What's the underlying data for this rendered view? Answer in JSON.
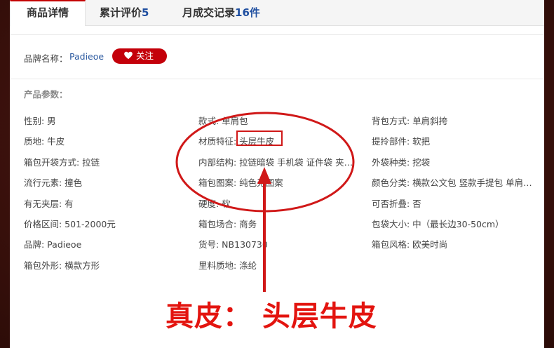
{
  "tabs": [
    {
      "label": "商品详情",
      "count": ""
    },
    {
      "label": "累计评价",
      "count": "5"
    },
    {
      "label": "月成交记录",
      "count": "16件"
    }
  ],
  "brand": {
    "label": "品牌名称：",
    "name": "Padieoe",
    "follow": "关注"
  },
  "section_title": "产品参数：",
  "params": [
    "性别: 男",
    "款式: 单肩包",
    "背包方式: 单肩斜挎",
    "质地: 牛皮",
    "材质特征: 头层牛皮",
    "提拎部件: 软把",
    "箱包开袋方式: 拉链",
    "内部结构: 拉链暗袋 手机袋 证件袋 夹…",
    "外袋种类: 挖袋",
    "流行元素: 撞色",
    "箱包图案: 纯色无图案",
    "颜色分类: 横款公文包 竖款手提包 单肩…",
    "有无夹层: 有",
    "硬度: 软",
    "可否折叠: 否",
    "价格区间: 501-2000元",
    "箱包场合: 商务",
    "包袋大小: 中（最长边30-50cm）",
    "品牌: Padieoe",
    "货号: NB130730",
    "箱包风格: 欧美时尚",
    "箱包外形: 横款方形",
    "里料质地: 涤纶",
    ""
  ],
  "caption": "真皮：  头层牛皮",
  "colors": {
    "accent": "#c40000",
    "annotation": "#e3140f",
    "link": "#2c5aa0",
    "background": "#3b110c"
  }
}
